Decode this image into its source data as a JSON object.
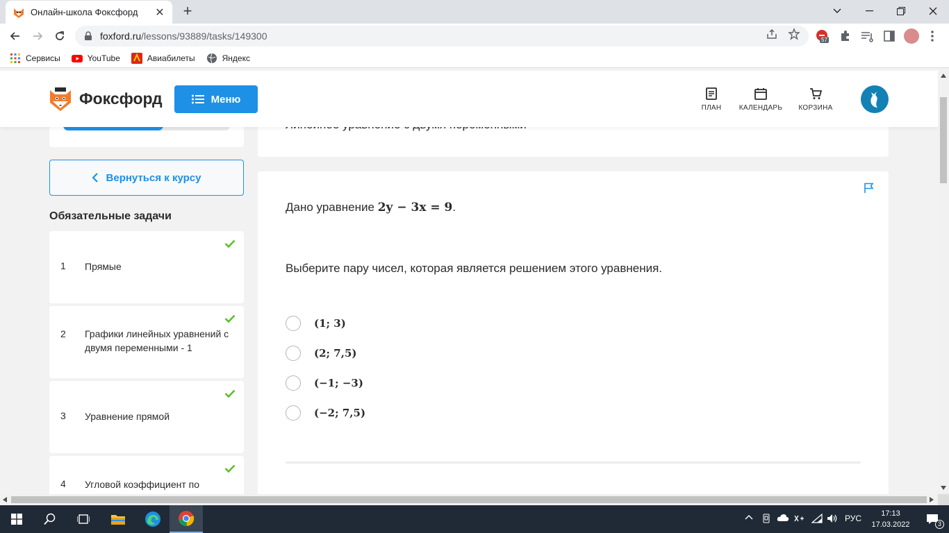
{
  "browser": {
    "tab_title": "Онлайн-школа Фоксфорд",
    "url_host": "foxford.ru",
    "url_path": "/lessons/93889/tasks/149300",
    "extension_badge": "57",
    "bookmarks": [
      {
        "label": "Сервисы",
        "icon": "apps-grid-icon"
      },
      {
        "label": "YouTube",
        "icon": "youtube-icon"
      },
      {
        "label": "Авиабилеты",
        "icon": "flights-icon"
      },
      {
        "label": "Яндекс",
        "icon": "globe-icon"
      }
    ]
  },
  "site": {
    "brand": "Фоксфорд",
    "menu_label": "Меню",
    "nav": [
      {
        "label": "ПЛАН",
        "icon": "plan-icon"
      },
      {
        "label": "КАЛЕНДАРЬ",
        "icon": "calendar-icon"
      },
      {
        "label": "КОРЗИНА",
        "icon": "cart-icon"
      }
    ],
    "accent_color": "#1e90e6",
    "check_color": "#5cbf2a"
  },
  "sidebar": {
    "progress_fraction": 0.6,
    "back_label": "Вернуться к курсу",
    "tasks_heading": "Обязательные задачи",
    "tasks": [
      {
        "num": "1",
        "name": "Прямые",
        "done": true
      },
      {
        "num": "2",
        "name": "Графики линейных уравнений с двумя переменными - 1",
        "done": true
      },
      {
        "num": "3",
        "name": "Уравнение прямой",
        "done": true
      },
      {
        "num": "4",
        "name": "Угловой коэффициент по",
        "done": true
      }
    ]
  },
  "lesson": {
    "title": "Линейное уравнение с двумя переменными"
  },
  "task": {
    "statement_prefix": "Дано уравнение ",
    "equation": "2y − 3x = 9",
    "statement_suffix": ".",
    "question": "Выберите пару чисел, которая является решением этого уравнения.",
    "options": [
      "(1; 3)",
      "(2; 7,5)",
      "(−1; −3)",
      "(−2; 7,5)"
    ]
  },
  "taskbar": {
    "language": "РУС",
    "time": "17:13",
    "date": "17.03.2022",
    "notifications": "3"
  }
}
